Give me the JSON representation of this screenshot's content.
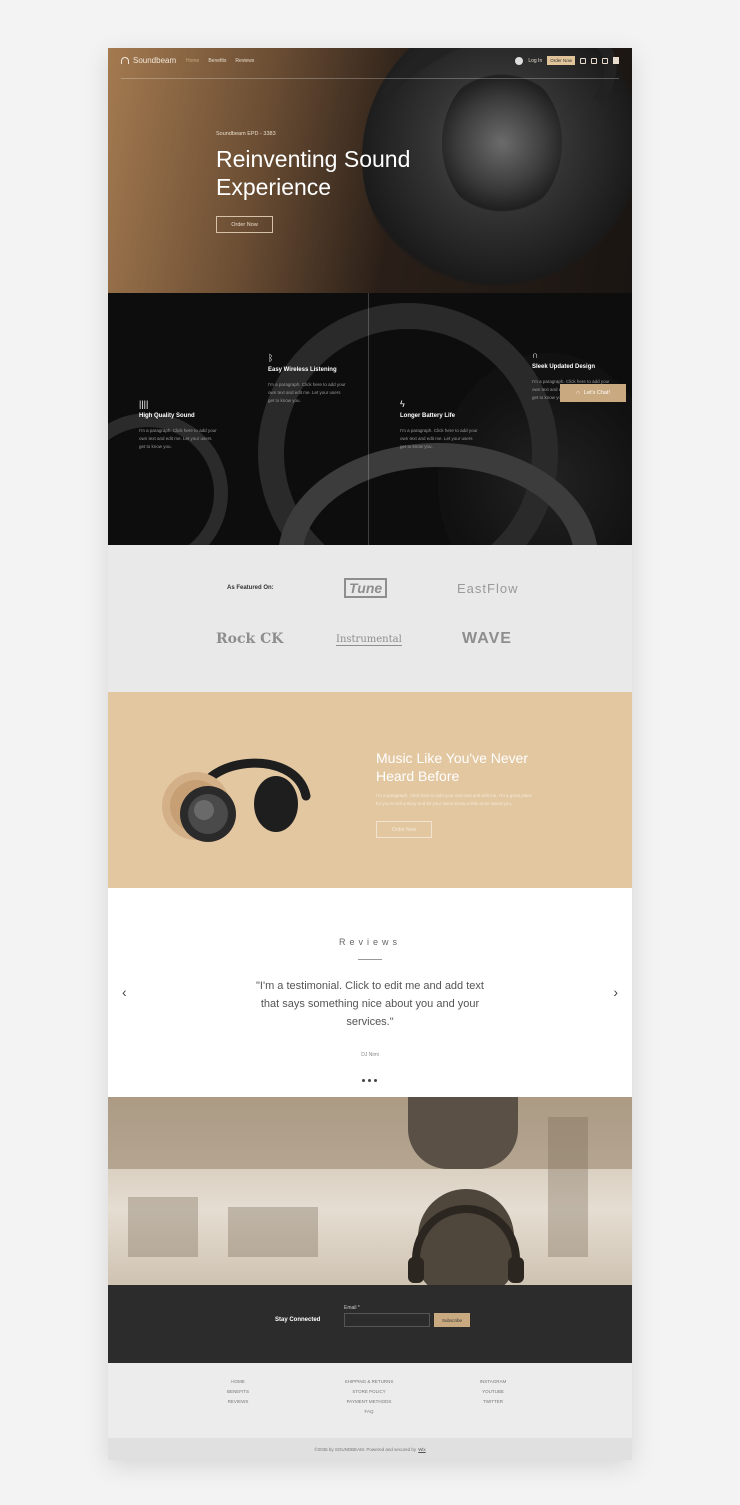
{
  "nav": {
    "brand": "Soundbeam",
    "links": [
      "Home",
      "Benefits",
      "Reviews"
    ],
    "login": "Log In",
    "order": "Order Now"
  },
  "hero": {
    "subtitle": "Soundbeam EPD - 3383",
    "title": "Reinventing Sound Experience",
    "button": "Order Now"
  },
  "features": [
    {
      "title": "Easy Wireless Listening",
      "desc": "I'm a paragraph. Click here to add your own text and edit me. Let your users get to know you.",
      "icon": "bluetooth-icon"
    },
    {
      "title": "Sleek Updated Design",
      "desc": "I'm a paragraph. Click here to add your own text and edit me. Let your users get to know you.",
      "icon": "headphones-icon"
    },
    {
      "title": "High Quality Sound",
      "desc": "I'm a paragraph. Click here to add your own text and edit me. Let your users get to know you.",
      "icon": "soundwave-icon"
    },
    {
      "title": "Longer Battery Life",
      "desc": "I'm a paragraph. Click here to add your own text and edit me. Let your users get to know you.",
      "icon": "bolt-icon"
    }
  ],
  "chat": {
    "label": "Let's Chat!"
  },
  "featured": {
    "label": "As Featured On:",
    "logos": [
      "Tune",
      "EastFlow",
      "Rock CK",
      "Instrumental",
      "WAVE"
    ]
  },
  "promo": {
    "title": "Music Like You've Never Heard Before",
    "text": "I'm a paragraph. Click here to add your own text and edit me. I'm a great place for you to tell a story and let your users know a little more about you.",
    "button": "Order Now"
  },
  "reviews": {
    "heading": "Reviews",
    "quote": "\"I'm a testimonial. Click to edit me and add text that says something nice about you and your services.\"",
    "author": "DJ Nimi"
  },
  "newsletter": {
    "label": "Stay Connected",
    "email_label": "Email *",
    "button": "Subscribe"
  },
  "footer": {
    "col1": [
      "HOME",
      "BENEFITS",
      "REVIEWS"
    ],
    "col2": [
      "SHIPPING & RETURNS",
      "STORE POLICY",
      "PAYMENT METHODS",
      "FAQ"
    ],
    "col3": [
      "INSTAGRAM",
      "YOUTUBE",
      "TWITTER"
    ],
    "copyright": "©2035 by SOUNDBEAM. Powered and secured by",
    "copyright_link": "Wix"
  },
  "colors": {
    "accent": "#c9a97f",
    "promo_bg": "#e3c7a0",
    "dark": "#2c2c2c"
  }
}
